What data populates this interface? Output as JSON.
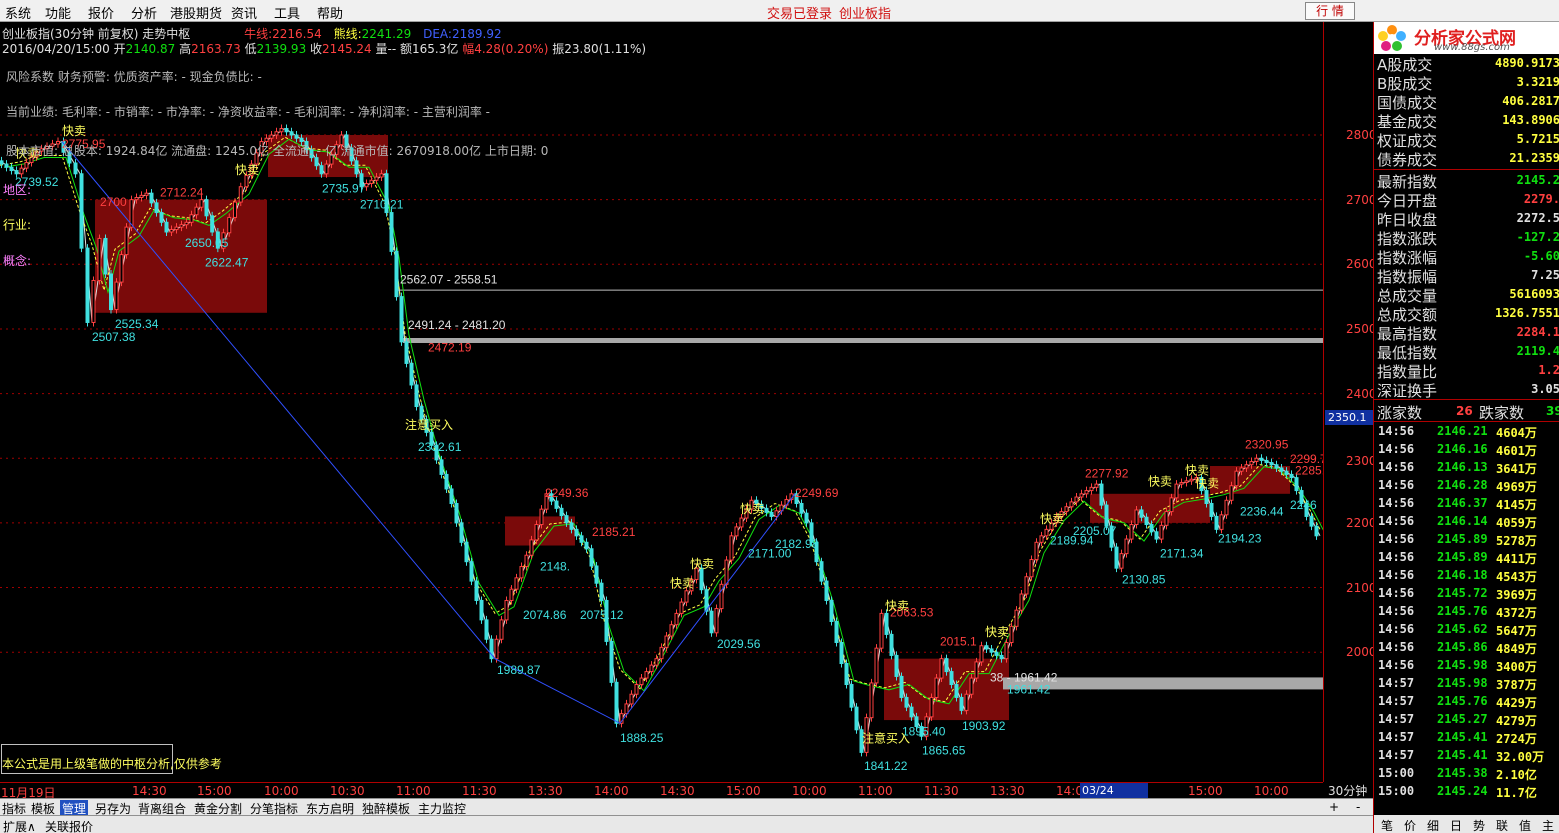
{
  "menu": {
    "items": [
      "系统",
      "功能",
      "报价",
      "分析",
      "港股期货",
      "资讯",
      "工具",
      "帮助"
    ],
    "login_status": "交易已登录",
    "current_index": "创业板指",
    "trade_button": "行 情"
  },
  "header": {
    "title": "创业板指(30分钟 前复权) 走势中枢",
    "niu_label": "牛线:",
    "niu_value": "2216.54",
    "xiong_label": "熊线:",
    "xiong_value": "2241.29",
    "dea_label": "DEA:",
    "dea_value": "2189.92",
    "date": "2016/04/20/15:00",
    "open_label": "开",
    "open": "2140.87",
    "high_label": "高",
    "high": "2163.73",
    "low_label": "低",
    "low": "2139.93",
    "close_label": "收",
    "close": "2145.24",
    "vol_label": "量--",
    "amount": "额165.3亿",
    "change": "幅4.28(0.20%)",
    "amplitude": "振23.80(1.11%)"
  },
  "overlay": {
    "risk_line": "风险系数 财务预警: 优质资产率: - 现金负债比: -",
    "profit_line": "当前业绩: 毛利率: - 市销率: - 市净率: - 净资收益率: - 毛利润率: - 净利润率: - 主营利润率 -",
    "share_line": "股本市值: 总股本: 1924.84亿 流通盘: 1245.0亿 全流通: - 亿 流通市值: 2670918.00亿 上市日期: 0",
    "region_label": "地区:",
    "industry_label": "行业:",
    "concept_label": "概念:",
    "formula_note": "本公式是用上级笔做的中枢分析,仅供参考"
  },
  "chart_data": {
    "type": "candlestick",
    "price_ticks": [
      "2800",
      "2700",
      "2600",
      "2500",
      "2400",
      "2300",
      "2200",
      "2100",
      "2000"
    ],
    "current_price_marker": "2350.1",
    "time_ticks": [
      "11月19日",
      "14:30",
      "15:00",
      "10:00",
      "10:30",
      "11:00",
      "11:30",
      "13:30",
      "14:00",
      "14:30",
      "15:00",
      "10:00",
      "11:00",
      "11:30",
      "13:30",
      "14:00",
      "15:00",
      "10:00"
    ],
    "time_cursor": "03/24 13:30",
    "period": "30分钟",
    "zone_labels": [
      "2562.07 - 2558.51",
      "2491.24 - 2481.20",
      "38 - 1961.42"
    ],
    "low_labels": [
      "2739.52",
      "2525.34",
      "2507.38",
      "2622.47",
      "2650.05",
      "2735.97",
      "2710.21",
      "2332.61",
      "2074.86",
      "2075.12",
      "1989.87",
      "2148.",
      "2171.00",
      "2182.98",
      "2029.56",
      "1888.25",
      "1895.40",
      "1865.65",
      "1903.92",
      "1841.22",
      "2189.94",
      "2205.07",
      "2130.85",
      "2171.34",
      "2194.23",
      "2236.44",
      "2246",
      "1961.42"
    ],
    "high_labels": [
      "2775.95",
      "2700",
      "2712.24",
      "2472.19",
      "2249.36",
      "2185.21",
      "2249.69",
      "2063.53",
      "2015.1",
      "2277.92",
      "2320.95",
      "2299.72",
      "2285.33"
    ],
    "signal_sell": "快卖",
    "signal_buy": "注意买入"
  },
  "tabs": {
    "items": [
      "指标",
      "模板",
      "管理",
      "另存为",
      "背离组合",
      "黄金分割",
      "分笔指标",
      "东方启明",
      "独醉模板",
      "主力监控"
    ],
    "active": "管理",
    "plus": "+",
    "minus": "-",
    "bottom": [
      "扩展∧",
      "关联报价"
    ]
  },
  "logo": {
    "text": "分析家公式网",
    "url": "www.88gs.com",
    "watermark": "399006 创业板指"
  },
  "stats": [
    {
      "label": "A股成交",
      "value": "4890.9173",
      "color": "#ffff40"
    },
    {
      "label": "B股成交",
      "value": "3.3219",
      "color": "#ffff40"
    },
    {
      "label": "国债成交",
      "value": "406.2817",
      "color": "#ffff40"
    },
    {
      "label": "基金成交",
      "value": "143.8906",
      "color": "#ffff40"
    },
    {
      "label": "权证成交",
      "value": "5.7215",
      "color": "#ffff40"
    },
    {
      "label": "债券成交",
      "value": "21.2359",
      "color": "#ffff40"
    }
  ],
  "index_stats": [
    {
      "label": "最新指数",
      "value": "2145.2",
      "color": "#10e010"
    },
    {
      "label": "今日开盘",
      "value": "2279.",
      "color": "#ff4040"
    },
    {
      "label": "昨日收盘",
      "value": "2272.5",
      "color": "#e0e0e0"
    },
    {
      "label": "指数涨跌",
      "value": "-127.2",
      "color": "#10e010"
    },
    {
      "label": "指数涨幅",
      "value": "-5.60",
      "color": "#10e010"
    },
    {
      "label": "指数振幅",
      "value": "7.25",
      "color": "#e0e0e0"
    },
    {
      "label": "总成交量",
      "value": "5616093",
      "color": "#ffff40"
    },
    {
      "label": "总成交额",
      "value": "1326.7551",
      "color": "#ffff40"
    },
    {
      "label": "最高指数",
      "value": "2284.1",
      "color": "#ff4040"
    },
    {
      "label": "最低指数",
      "value": "2119.4",
      "color": "#10e010"
    },
    {
      "label": "指数量比",
      "value": "1.2",
      "color": "#ff4040"
    },
    {
      "label": "深证换手",
      "value": "3.05",
      "color": "#e0e0e0"
    }
  ],
  "updown": {
    "up_label": "涨家数",
    "up_value": "26",
    "down_label": "跌家数",
    "down_value": "39"
  },
  "ticks": [
    {
      "time": "14:56",
      "price": "2146.21",
      "vol": "4604万"
    },
    {
      "time": "14:56",
      "price": "2146.16",
      "vol": "4601万"
    },
    {
      "time": "14:56",
      "price": "2146.13",
      "vol": "3641万"
    },
    {
      "time": "14:56",
      "price": "2146.28",
      "vol": "4969万"
    },
    {
      "time": "14:56",
      "price": "2146.37",
      "vol": "4145万"
    },
    {
      "time": "14:56",
      "price": "2146.14",
      "vol": "4059万"
    },
    {
      "time": "14:56",
      "price": "2145.89",
      "vol": "5278万"
    },
    {
      "time": "14:56",
      "price": "2145.89",
      "vol": "4411万"
    },
    {
      "time": "14:56",
      "price": "2146.18",
      "vol": "4543万"
    },
    {
      "time": "14:56",
      "price": "2145.72",
      "vol": "3969万"
    },
    {
      "time": "14:56",
      "price": "2145.76",
      "vol": "4372万"
    },
    {
      "time": "14:56",
      "price": "2145.62",
      "vol": "5647万"
    },
    {
      "time": "14:56",
      "price": "2145.86",
      "vol": "4849万"
    },
    {
      "time": "14:56",
      "price": "2145.98",
      "vol": "3400万"
    },
    {
      "time": "14:57",
      "price": "2145.98",
      "vol": "3787万"
    },
    {
      "time": "14:57",
      "price": "2145.76",
      "vol": "4429万"
    },
    {
      "time": "14:57",
      "price": "2145.27",
      "vol": "4279万"
    },
    {
      "time": "14:57",
      "price": "2145.41",
      "vol": "2724万"
    },
    {
      "time": "14:57",
      "price": "2145.41",
      "vol": "32.00万"
    },
    {
      "time": "15:00",
      "price": "2145.38",
      "vol": "2.10亿"
    },
    {
      "time": "15:00",
      "price": "2145.24",
      "vol": "11.7亿"
    }
  ],
  "right_tabs": [
    "笔",
    "价",
    "细",
    "日",
    "势",
    "联",
    "值",
    "主"
  ],
  "colors": {
    "up": "#ff4040",
    "down": "#40e0e0",
    "zone": "#7a0a0a",
    "bg": "#000000",
    "axis": "#b00000",
    "signal": "#ffff60"
  }
}
